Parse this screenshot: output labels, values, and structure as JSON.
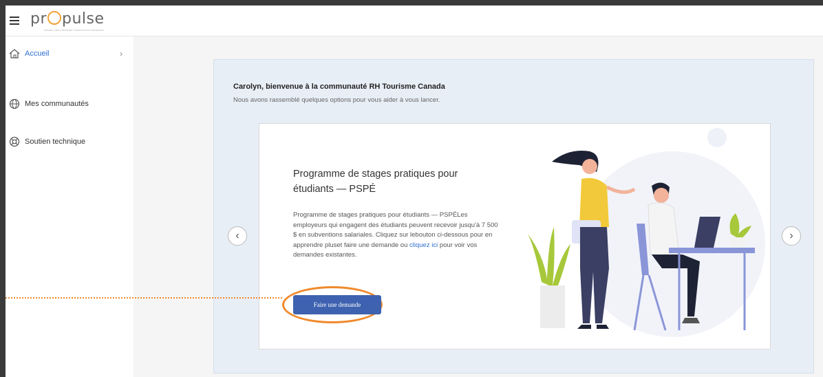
{
  "app": {
    "logo_text_pre": "pr",
    "logo_text_post": "pulse",
    "logo_tagline": "réseau des tourisme ressources humaines"
  },
  "sidebar": {
    "items": [
      {
        "label": "Accueil",
        "icon": "home-icon",
        "active": true
      },
      {
        "label": "Mes communautés",
        "icon": "globe-icon",
        "active": false
      },
      {
        "label": "Soutien technique",
        "icon": "lifebuoy-icon",
        "active": false
      }
    ]
  },
  "main": {
    "welcome_title": "Carolyn, bienvenue à la communauté RH Tourisme Canada",
    "welcome_subtitle": "Nous avons rassemblé quelques options pour vous aider à vous lancer.",
    "card": {
      "title": "Programme de stages pratiques pour étudiants — PSPÉ",
      "body_part1": "Programme de stages pratiques pour étudiants — PSPÉLes employeurs qui engagent des étudiants peuvent recevoir jusqu'à 7 500 $ en subventions salariales. Cliquez sur lebouton ci-dessous pour en apprendre pluset faire une demande ou ",
      "body_link": "cliquez ici",
      "body_part2": " pour voir vos demandes existantes.",
      "button_label": "Faire une demande"
    }
  },
  "colors": {
    "accent_blue": "#3e62b0",
    "highlight_orange": "#ef8a2c",
    "panel_bg": "#e8eef6"
  }
}
